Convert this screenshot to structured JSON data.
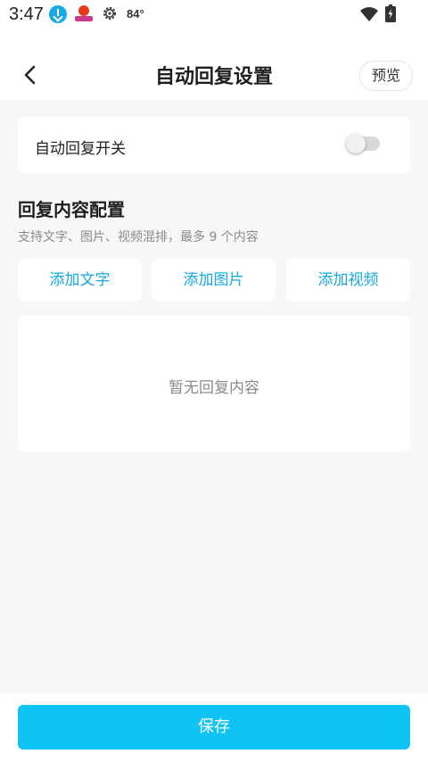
{
  "status_bar": {
    "time": "3:47",
    "temperature": "84°",
    "icons": [
      "download-icon",
      "app-notification-icon",
      "settings-gear-icon",
      "wifi-icon",
      "battery-charging-icon"
    ]
  },
  "header": {
    "title": "自动回复设置",
    "preview_label": "预览",
    "back_icon": "back-chevron-icon"
  },
  "auto_reply_switch": {
    "label": "自动回复开关",
    "enabled": false
  },
  "content_config": {
    "title": "回复内容配置",
    "subtitle": "支持文字、图片、视频混排，最多 9 个内容",
    "add_buttons": [
      "添加文字",
      "添加图片",
      "添加视频"
    ],
    "empty_text": "暂无回复内容"
  },
  "footer": {
    "save_label": "保存"
  },
  "colors": {
    "accent": "#10c3f5",
    "link": "#16a8de",
    "background": "#f7f7f8"
  }
}
